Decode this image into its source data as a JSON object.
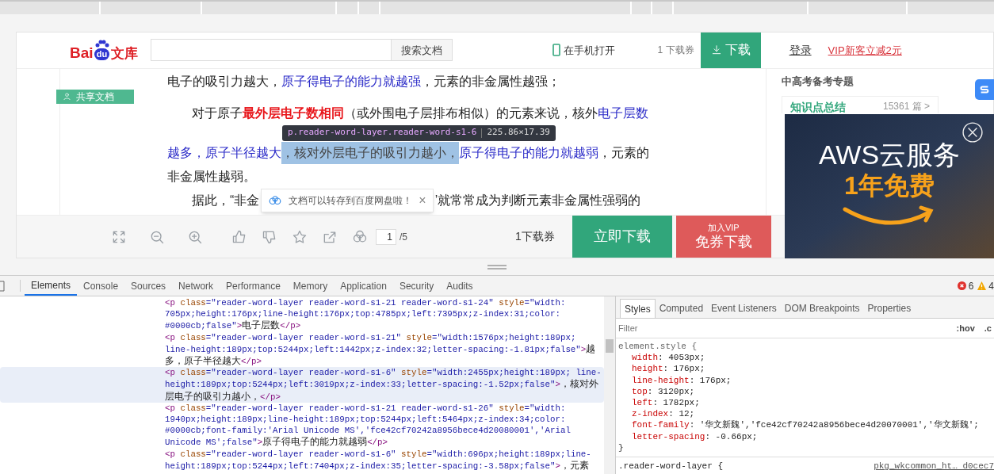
{
  "header": {
    "logo": {
      "left": "Bai",
      "paw": "du",
      "right": "文库"
    },
    "search": {
      "button": "搜索文档"
    },
    "phone_link": "在手机打开",
    "ticket": "1 下载券",
    "download_button": "下载",
    "login": "登录",
    "vip_offer": "VIP新客立减2元"
  },
  "ribbon": "共享文档",
  "document": {
    "lines": [
      {
        "indent": false,
        "segments": [
          {
            "kind": "normal",
            "text": "电子的吸引力越大，"
          },
          {
            "kind": "blue",
            "text": "原子得电子的能力就越强"
          },
          {
            "kind": "normal",
            "text": "，元素的非金属性越强；"
          }
        ]
      },
      {
        "indent": true,
        "segments": [
          {
            "kind": "normal",
            "text": "对于原子"
          },
          {
            "kind": "red",
            "text": "最外层电子数相同"
          },
          {
            "kind": "normal",
            "text": "（或外围电子层排布相似）的元素来说，核外"
          },
          {
            "kind": "blue",
            "text": "电子层数"
          }
        ]
      },
      {
        "indent": false,
        "segments": [
          {
            "kind": "blue",
            "text": "越多，原子半径越大"
          },
          {
            "kind": "highlight",
            "text": "，核对外层电子的吸引力越小，"
          },
          {
            "kind": "blue",
            "text": "原子得电子的能力就越弱"
          },
          {
            "kind": "normal",
            "text": "，元素的"
          }
        ]
      },
      {
        "indent": false,
        "segments": [
          {
            "kind": "normal",
            "text": "非金属性越弱。"
          }
        ]
      },
      {
        "indent": true,
        "segments": [
          {
            "kind": "normal",
            "text": "据此，“非金"
          },
          {
            "kind": "toast",
            "text": "文档可以转存到百度网盘啦！",
            "close": "×"
          },
          {
            "kind": "normal",
            "text": "’就常常成为判断元素非金属性强弱的"
          }
        ]
      }
    ]
  },
  "inspect_tooltip": {
    "selector": "p.reader-word-layer.reader-word-s1-6",
    "size": "225.86×17.39"
  },
  "sidebar": {
    "title": "中高考备考专题",
    "item": {
      "name": "知识点总结",
      "count": "15361 篇 >"
    }
  },
  "ad": {
    "title": "AWS云服务",
    "subtitle": "1年免费"
  },
  "toolbar": {
    "page": "1",
    "total": "/5",
    "ticket": "1下载券",
    "download_now": "立即下载",
    "vip_top": "加入VIP",
    "vip_bottom": "免券下载"
  },
  "devtools": {
    "tabs": [
      {
        "label": "Elements",
        "selected": true
      },
      {
        "label": "Console",
        "selected": false
      },
      {
        "label": "Sources",
        "selected": false
      },
      {
        "label": "Network",
        "selected": false
      },
      {
        "label": "Performance",
        "selected": false
      },
      {
        "label": "Memory",
        "selected": false
      },
      {
        "label": "Application",
        "selected": false
      },
      {
        "label": "Security",
        "selected": false
      },
      {
        "label": "Audits",
        "selected": false
      }
    ],
    "errors": "6",
    "warnings": "4",
    "nodes": [
      {
        "selected": false,
        "open": "<p",
        "attrs": [
          {
            "name": " class",
            "value": "=\"reader-word-layer reader-word-s1-21 reader-word-s1-24\""
          },
          {
            "name": " style",
            "value": "=\"width: 705px;height:176px;line-height:176px;top:4785px;left:7395px;z-index:31;color: #0000cb;false\""
          }
        ],
        "gt": ">",
        "text": "电子层数",
        "close": "</p>"
      },
      {
        "selected": false,
        "open": "<p",
        "attrs": [
          {
            "name": " class",
            "value": "=\"reader-word-layer reader-word-s1-21\""
          },
          {
            "name": " style",
            "value": "=\"width:1576px;height:189px; line-height:189px;top:5244px;left:1442px;z-index:32;letter-spacing:-1.81px;false\""
          }
        ],
        "gt": ">",
        "text": "越多，原子半径越大",
        "close": "</p>"
      },
      {
        "selected": true,
        "open": "<p",
        "attrs": [
          {
            "name": " class",
            "value": "=\"reader-word-layer reader-word-s1-6\""
          },
          {
            "name": " style",
            "value": "=\"width:2455px;height:189px; line-height:189px;top:5244px;left:3019px;z-index:33;letter-spacing:-1.52px;false\""
          }
        ],
        "gt": ">",
        "text": "，核对外层电子的吸引力越小，",
        "close": "</p>"
      },
      {
        "selected": false,
        "open": "<p",
        "attrs": [
          {
            "name": " class",
            "value": "=\"reader-word-layer reader-word-s1-21 reader-word-s1-26\""
          },
          {
            "name": " style",
            "value": "=\"width: 1940px;height:189px;line-height:189px;top:5244px;left:5464px;z-index:34;color: #0000cb;font-family:'Arial Unicode MS','fce42cf70242a8956bece4d20080001','Arial Unicode MS';false\""
          }
        ],
        "gt": ">",
        "text": "原子得电子的能力就越弱",
        "close": "</p>"
      },
      {
        "selected": false,
        "open": "<p",
        "attrs": [
          {
            "name": " class",
            "value": "=\"reader-word-layer reader-word-s1-6\""
          },
          {
            "name": " style",
            "value": "=\"width:696px;height:189px;line-height:189px;top:5244px;left:7404px;z-index:35;letter-spacing:-3.58px;false\""
          }
        ],
        "gt": ">",
        "text": "，元素"
      }
    ],
    "side_tabs": [
      {
        "label": "Styles",
        "selected": true
      },
      {
        "label": "Computed",
        "selected": false
      },
      {
        "label": "Event Listeners",
        "selected": false
      },
      {
        "label": "DOM Breakpoints",
        "selected": false
      },
      {
        "label": "Properties",
        "selected": false
      }
    ],
    "filter": {
      "placeholder": "Filter",
      "hov": ":hov",
      "cls": ".c"
    },
    "rule": {
      "selector": "element.style {",
      "props": [
        {
          "name": "width",
          "value": ": 4053px;"
        },
        {
          "name": "height",
          "value": ": 176px;"
        },
        {
          "name": "line-height",
          "value": ": 176px;"
        },
        {
          "name": "top",
          "value": ": 3120px;"
        },
        {
          "name": "left",
          "value": ": 1782px;"
        },
        {
          "name": "z-index",
          "value": ": 12;"
        },
        {
          "name": "font-family",
          "value": ": '华文新魏','fce42cf70242a8956bece4d20070001','华文新魏';"
        },
        {
          "name": "letter-spacing",
          "value": ": -0.66px;"
        }
      ],
      "close": "}"
    },
    "next_rule": {
      "selector": ".reader-word-layer {",
      "source": "pkg_wkcommon_ht… d0cec7"
    }
  }
}
